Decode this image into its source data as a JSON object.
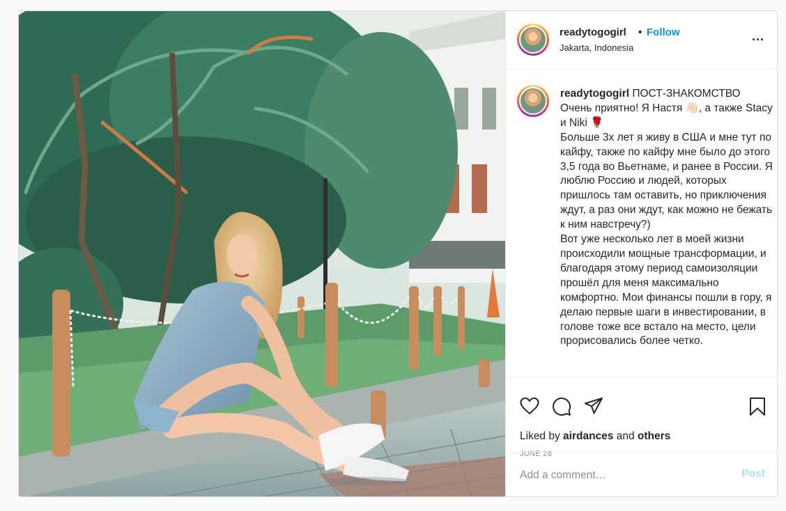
{
  "post": {
    "username": "readytogogirl",
    "separator": "•",
    "follow_label": "Follow",
    "location": "Jakarta, Indonesia",
    "more_label": "...",
    "photo_alt": "Photo by readytogogirl",
    "caption_username": "readytogogirl",
    "caption_text": " ПОСТ-ЗНАКОМСТВО\nОчень приятно! Я Настя 👋🏻, а также Stacy и Niki 🌹\nБольше 3х лет я живу в США и мне тут по кайфу, также по кайфу мне было до этого 3,5 года во Вьетнаме, и ранее в России. Я люблю Россию и людей, которых пришлось там оставить, но приключения ждут, а раз они ждут, как можно не бежать к ним навстречу?)\nВот уже несколько лет в моей жизни происходили мощные трансформации, и благодаря этому период самоизоляции прошёл для меня максимально комфортно. Мои финансы пошли в гору, я делаю первые шаги в инвестировании, в голове тоже все встало на место, цели прорисовались более четко.",
    "liked_by_prefix": "Liked by ",
    "liked_by_user": "airdances",
    "liked_by_and": " and ",
    "liked_by_others": "others",
    "date": "JUNE 26",
    "comment_placeholder": "Add a comment…",
    "post_button": "Post"
  },
  "icons": {
    "like": "heart-icon",
    "comment": "comment-icon",
    "share": "paper-plane-icon",
    "save": "bookmark-icon",
    "more": "more-horizontal-icon"
  },
  "colors": {
    "accent": "#0095f6",
    "post_disabled": "#b2dffc",
    "text": "#262626",
    "muted": "#8e8e8e",
    "border": "#dbdbdb"
  }
}
